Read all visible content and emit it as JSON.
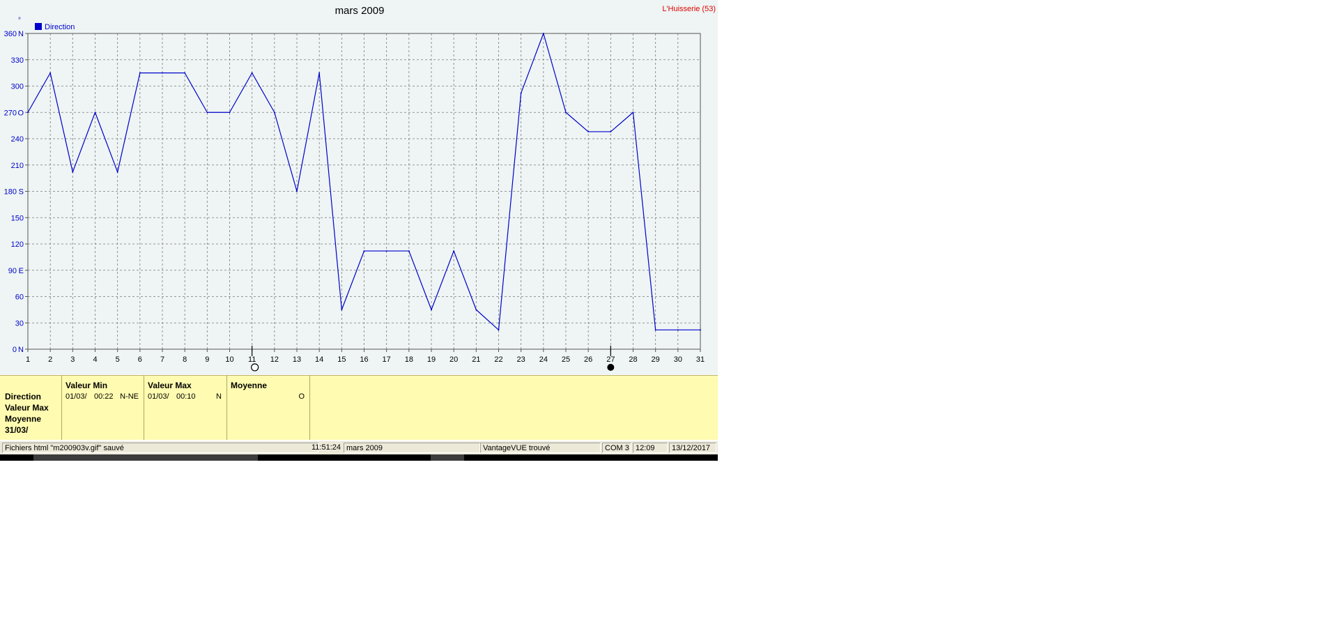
{
  "chart_data": {
    "type": "line",
    "title": "mars 2009",
    "station": "L'Huisserie (53)",
    "unit_marker": "°",
    "legend": [
      {
        "name": "Direction",
        "color": "#0000cc"
      }
    ],
    "legend_position": "top-left",
    "grid": true,
    "x_ticks": [
      1,
      2,
      3,
      4,
      5,
      6,
      7,
      8,
      9,
      10,
      11,
      12,
      13,
      14,
      15,
      16,
      17,
      18,
      19,
      20,
      21,
      22,
      23,
      24,
      25,
      26,
      27,
      28,
      29,
      30,
      31
    ],
    "xlim": [
      1,
      31
    ],
    "ylim": [
      0,
      360
    ],
    "y_ticks": [
      {
        "value": 0,
        "label": "0",
        "dir": "N"
      },
      {
        "value": 30,
        "label": "30",
        "dir": ""
      },
      {
        "value": 60,
        "label": "60",
        "dir": ""
      },
      {
        "value": 90,
        "label": "90",
        "dir": "E"
      },
      {
        "value": 120,
        "label": "120",
        "dir": ""
      },
      {
        "value": 150,
        "label": "150",
        "dir": ""
      },
      {
        "value": 180,
        "label": "180",
        "dir": "S"
      },
      {
        "value": 210,
        "label": "210",
        "dir": ""
      },
      {
        "value": 240,
        "label": "240",
        "dir": ""
      },
      {
        "value": 270,
        "label": "270",
        "dir": "O"
      },
      {
        "value": 300,
        "label": "300",
        "dir": ""
      },
      {
        "value": 330,
        "label": "330",
        "dir": ""
      },
      {
        "value": 360,
        "label": "360",
        "dir": "N"
      }
    ],
    "series": [
      {
        "name": "Direction",
        "color": "#0000cc",
        "x": [
          1,
          2,
          3,
          4,
          5,
          6,
          7,
          8,
          9,
          10,
          11,
          12,
          13,
          14,
          15,
          16,
          17,
          18,
          19,
          20,
          21,
          22,
          23,
          24,
          25,
          26,
          27,
          28,
          29,
          30,
          31
        ],
        "values": [
          270,
          315,
          202,
          270,
          202,
          315,
          315,
          315,
          270,
          270,
          315,
          270,
          180,
          315,
          45,
          112,
          112,
          112,
          45,
          112,
          45,
          22,
          292,
          360,
          270,
          248,
          248,
          270,
          22,
          22,
          22
        ]
      }
    ],
    "moon_phases": [
      {
        "day": 11,
        "phase": "full"
      },
      {
        "day": 27,
        "phase": "new"
      }
    ]
  },
  "stats": {
    "row_labels": [
      "Direction",
      "Valeur Max",
      "Moyenne",
      "31/03/"
    ],
    "columns": [
      {
        "header": "Valeur Min",
        "date": "01/03/",
        "time": "00:22",
        "value": "N-NE"
      },
      {
        "header": "Valeur Max",
        "date": "01/03/",
        "time": "00:10",
        "value": "N"
      },
      {
        "header": "Moyenne",
        "date": "",
        "time": "",
        "value": "O"
      }
    ]
  },
  "statusbar": {
    "message": "Fichiers html  \"m200903v.gif\"  sauvé",
    "time": "11:51:24",
    "period": "mars 2009",
    "station_status": "VantageVUE trouvé",
    "port": "COM 3",
    "clock": "12:09",
    "date": "13/12/2017"
  },
  "colors": {
    "plot_bg": "#eef5f4",
    "axis_text": "#0000cc",
    "title_text": "#000000",
    "station_text": "#e00000",
    "stats_bg": "#fffbb0"
  }
}
